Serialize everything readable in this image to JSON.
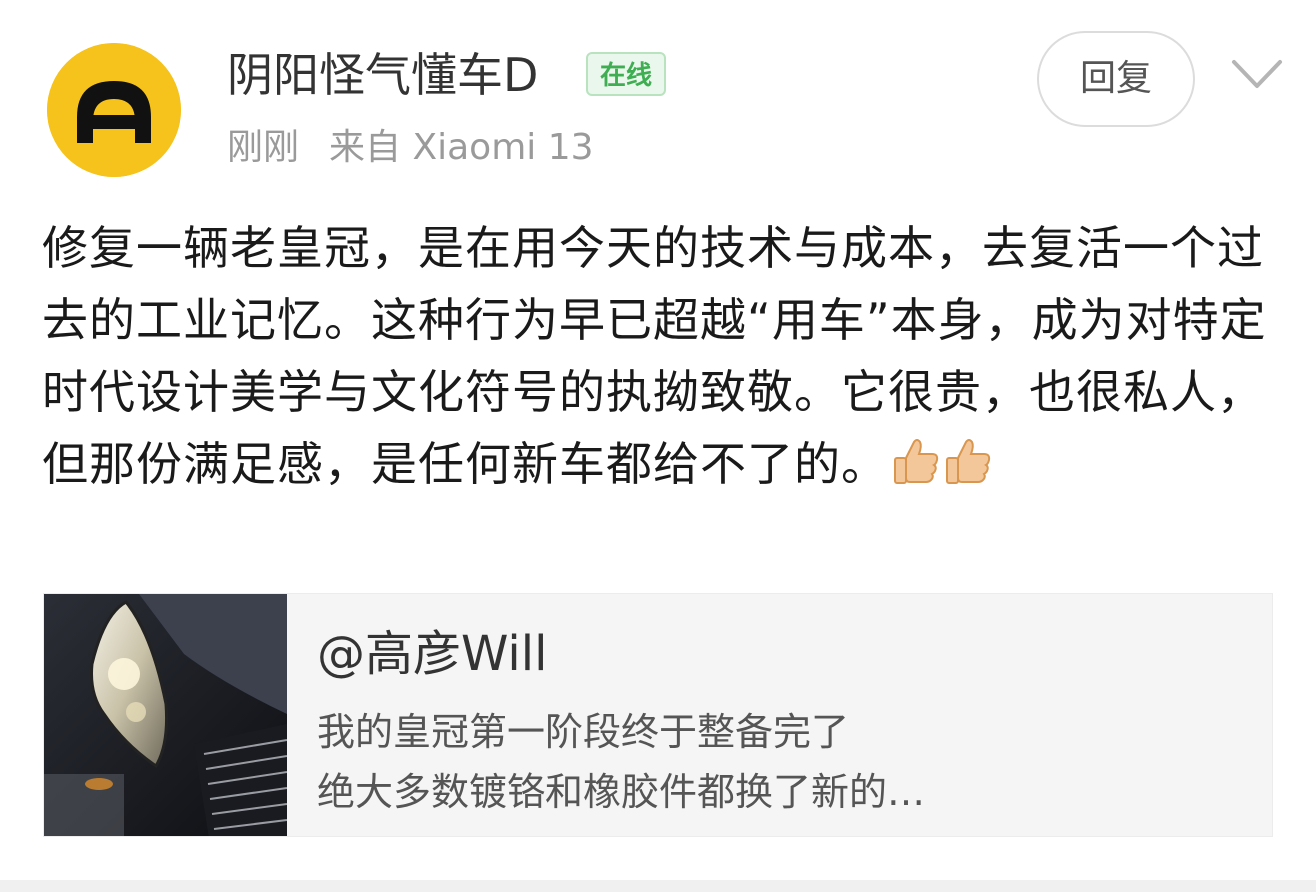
{
  "post": {
    "author": {
      "name": "阴阳怪气懂车D",
      "status": "在线",
      "avatar_icon": "steering-wheel-logo",
      "avatar_color": "#f6c21c"
    },
    "time": "刚刚",
    "source": "来自 Xiaomi 13",
    "reply_label": "回复",
    "more_icon": "chevron-down-icon",
    "text": "修复一辆老皇冠，是在用今天的技术与成本，去复活一个过去的工业记忆。这种行为早已超越“用车”本身，成为对特定时代设计美学与文化符号的执拗致敬。它很贵，也很私人，但那份满足感，是任何新车都给不了的。",
    "emojis": [
      "thumbs-up-icon",
      "thumbs-up-icon"
    ]
  },
  "repost": {
    "author": "@高彦Will",
    "line1": "我的皇冠第一阶段终于整备完了",
    "line2": "绝大多数镀铬和橡胶件都换了新的…",
    "thumbnail": "car-headlight-photo"
  },
  "colors": {
    "online_green": "#3fae52",
    "meta_gray": "#9a9a9a",
    "card_bg": "#f5f5f5"
  }
}
